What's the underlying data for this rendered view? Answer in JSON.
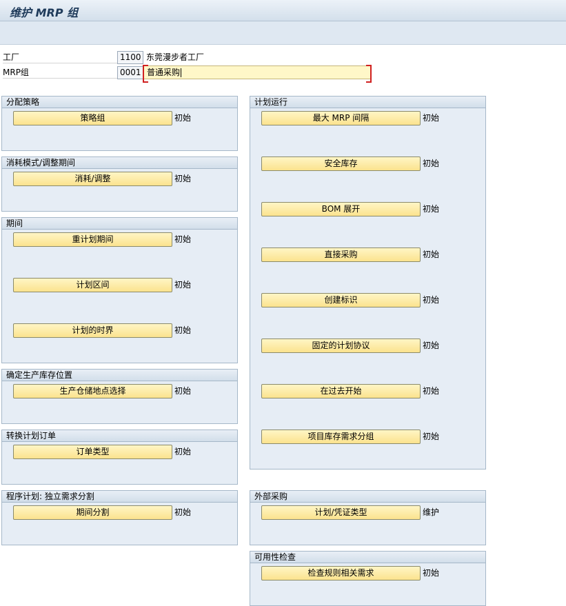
{
  "title": "维护 MRP 组",
  "header": {
    "plant": {
      "label": "工厂",
      "value": "1100",
      "description": "东莞漫步者工厂"
    },
    "mrp_group": {
      "label": "MRP组",
      "value": "0001",
      "description": "普通采购"
    }
  },
  "panels": {
    "allocation_strategy": {
      "title": "分配策略",
      "items": [
        {
          "label": "策略组",
          "status": "初始"
        }
      ]
    },
    "consumption_mode": {
      "title": "消耗模式/调整期间",
      "items": [
        {
          "label": "消耗/调整",
          "status": "初始"
        }
      ]
    },
    "period": {
      "title": "期间",
      "items": [
        {
          "label": "重计划期间",
          "status": "初始"
        },
        {
          "label": "计划区间",
          "status": "初始"
        },
        {
          "label": "计划的时界",
          "status": "初始"
        }
      ]
    },
    "production_storage": {
      "title": "确定生产库存位置",
      "items": [
        {
          "label": "生产仓储地点选择",
          "status": "初始"
        }
      ]
    },
    "convert_planned_order": {
      "title": "转换计划订单",
      "items": [
        {
          "label": "订单类型",
          "status": "初始"
        }
      ]
    },
    "program_planning": {
      "title": "程序计划: 独立需求分割",
      "items": [
        {
          "label": "期间分割",
          "status": "初始"
        }
      ]
    },
    "planning_run": {
      "title": "计划运行",
      "items": [
        {
          "label": "最大 MRP 间隔",
          "status": "初始"
        },
        {
          "label": "安全库存",
          "status": "初始"
        },
        {
          "label": "BOM 展开",
          "status": "初始"
        },
        {
          "label": "直接采购",
          "status": "初始"
        },
        {
          "label": "创建标识",
          "status": "初始"
        },
        {
          "label": "固定的计划协议",
          "status": "初始"
        },
        {
          "label": "在过去开始",
          "status": "初始"
        },
        {
          "label": "项目库存需求分组",
          "status": "初始"
        }
      ]
    },
    "external_procurement": {
      "title": "外部采购",
      "items": [
        {
          "label": "计划/凭证类型",
          "status": "维护"
        }
      ]
    },
    "availability_check": {
      "title": "可用性检查",
      "items": [
        {
          "label": "检查规则相关需求",
          "status": "初始"
        }
      ]
    }
  }
}
